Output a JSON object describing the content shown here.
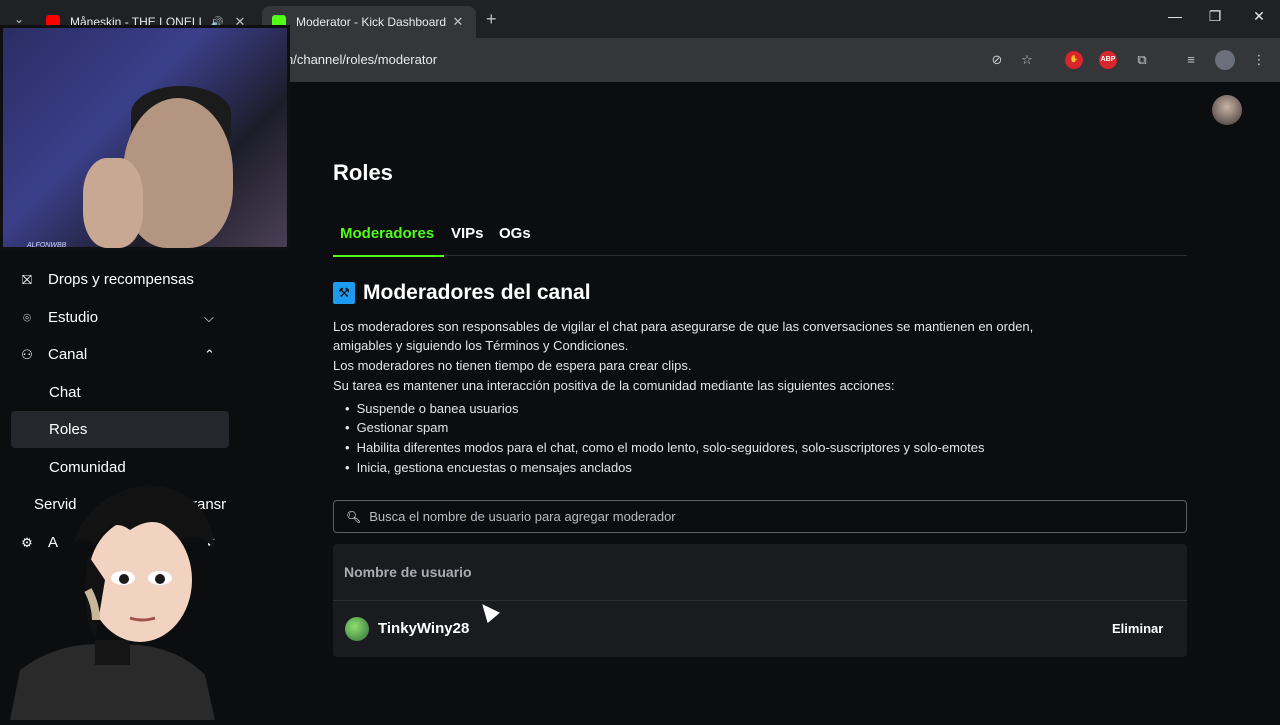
{
  "browser": {
    "tabs": [
      {
        "title": "Måneskin - THE LONELIEST",
        "active": false,
        "audio": true
      },
      {
        "title": "Moderator - Kick Dashboard",
        "active": true
      }
    ],
    "url": "n/channel/roles/moderator",
    "extension_badge": "ABP"
  },
  "webcam": {
    "watermark": "ALFONWBB"
  },
  "sidebar": {
    "items": [
      {
        "label": "Drops y recompensas",
        "icon": "gift-icon"
      },
      {
        "label": "Estudio",
        "icon": "studio-icon",
        "expanded": false
      },
      {
        "label": "Canal",
        "icon": "channel-icon",
        "expanded": true
      },
      {
        "label": "Chat",
        "sub": true
      },
      {
        "label": "Roles",
        "sub": true,
        "active": true
      },
      {
        "label": "Comunidad",
        "sub": true
      },
      {
        "label": "Servid",
        "trail": "ransr"
      },
      {
        "label": "A",
        "icon": "gear-icon"
      }
    ]
  },
  "page": {
    "title": "Roles",
    "tabs": [
      "Moderadores",
      "VIPs",
      "OGs"
    ],
    "section_title": "Moderadores del canal",
    "description": [
      "Los moderadores son responsables de vigilar el chat para asegurarse de que las conversaciones se mantienen en orden,",
      "amigables y siguiendo los Términos y Condiciones.",
      "Los moderadores no tienen tiempo de espera para crear clips.",
      "Su tarea es mantener una interacción positiva de la comunidad mediante las siguientes acciones:"
    ],
    "bullets": [
      "Suspende o banea usuarios",
      "Gestionar spam",
      "Habilita diferentes modos para el chat, como el modo lento, solo-seguidores, solo-suscriptores y solo-emotes",
      "Inicia, gestiona encuestas o mensajes anclados"
    ],
    "search_placeholder": "Busca el nombre de usuario para agregar moderador",
    "table_header": "Nombre de usuario",
    "rows": [
      {
        "username": "TinkyWiny28",
        "action": "Eliminar"
      }
    ]
  },
  "colors": {
    "accent": "#53fc18",
    "background": "#0b0d0e",
    "panel": "#191b1f"
  }
}
